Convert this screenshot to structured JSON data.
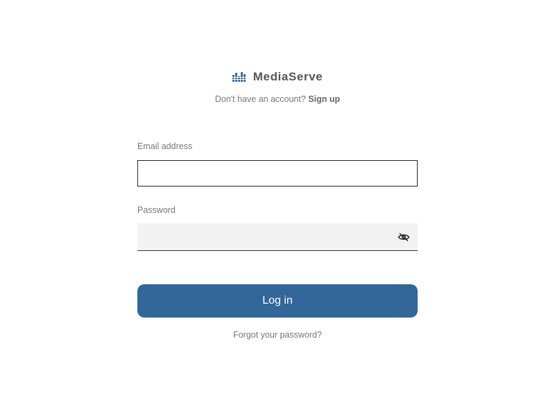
{
  "brand": {
    "name": "MediaServe",
    "logo_icon": "equalizer-bars-logo",
    "logo_color": "#3a6fa0"
  },
  "signup": {
    "prompt": "Don't have an account?",
    "link_label": "Sign up"
  },
  "form": {
    "email_label": "Email address",
    "email_value": "",
    "password_label": "Password",
    "password_value": "",
    "show_password_icon": "eye-hidden-icon"
  },
  "actions": {
    "login_label": "Log in",
    "forgot_label": "Forgot your password?"
  },
  "colors": {
    "primary_button": "#336699",
    "label_text": "#777777",
    "password_field_bg": "#f2f2f2"
  }
}
